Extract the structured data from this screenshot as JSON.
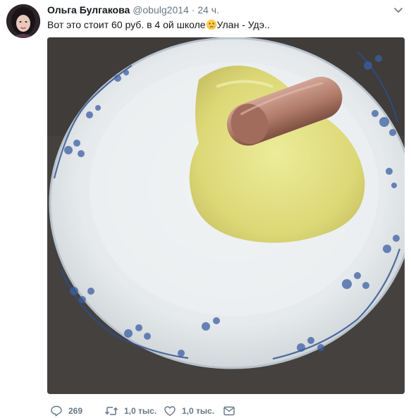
{
  "tweet": {
    "author_name": "Ольга Булгакова",
    "handle": "@obulg2014",
    "separator": "·",
    "time": "24 ч.",
    "text_before_emoji": "Вот это стоит 60 руб. в 4 ой школе",
    "text_after_emoji": "Улан - Удэ..",
    "emoji_icon": "face-with-tear-emoji"
  },
  "actions": {
    "reply_count": "269",
    "retweet_count": "1,0 тыс.",
    "like_count": "1,0 тыс."
  },
  "icons": {
    "reply": "speech-bubble-icon",
    "retweet": "retweet-arrows-icon",
    "like": "heart-icon",
    "message": "envelope-icon",
    "menu": "chevron-down-icon"
  },
  "colors": {
    "text": "#14171a",
    "secondary": "#657786"
  }
}
